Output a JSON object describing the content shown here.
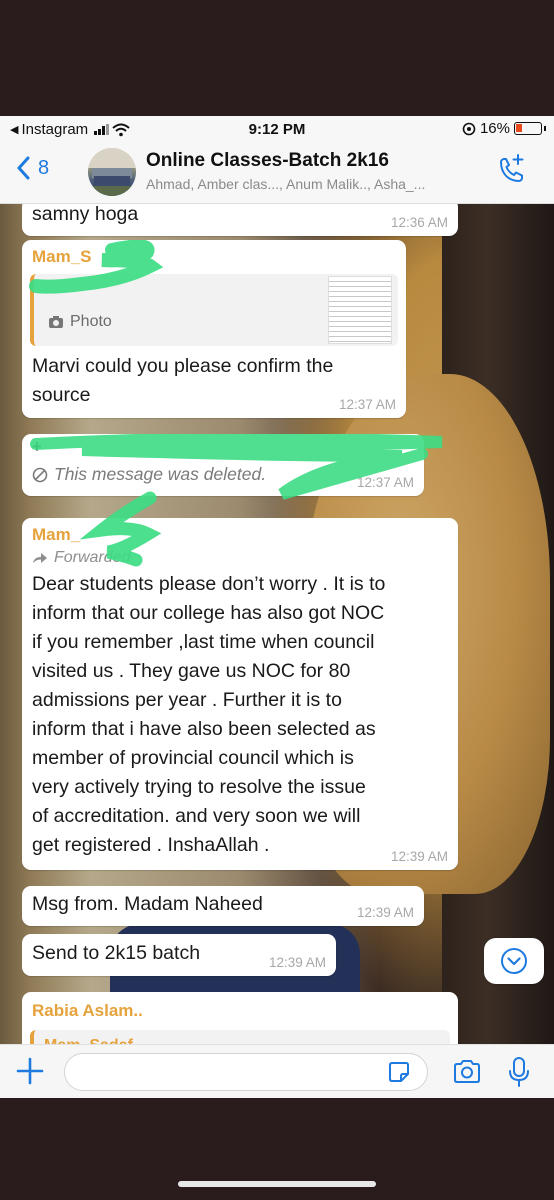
{
  "status_bar": {
    "back_app": "Instagram",
    "time": "9:12 PM",
    "battery": "16%"
  },
  "header": {
    "back_count": "8",
    "title": "Online Classes-Batch 2k16",
    "members": "Ahmad, Amber clas..., Anum Malik.., Asha_..."
  },
  "messages": {
    "m1": {
      "text": "samny hoga",
      "time": "12:36 AM"
    },
    "m2": {
      "sender": "Mam_S",
      "quote_label": "Photo",
      "text_line1": "Marvi could you please confirm the",
      "text_line2": "source",
      "time": "12:37 AM"
    },
    "m3": {
      "sender": "+",
      "deleted": "This message was deleted.",
      "time": "12:37 AM"
    },
    "m4": {
      "sender": "Mam_",
      "forwarded": "Forwarded",
      "lines": [
        "Dear students please don’t worry . It is to",
        "inform that our college has also got NOC",
        "if you remember ,last time when council",
        "visited us . They gave us NOC for 80",
        "admissions per year . Further it is to",
        "inform that i have also been selected as",
        "member of provincial council which is",
        "very actively trying to resolve the issue",
        "of accreditation. and very soon we will",
        "get registered . InshaAllah ."
      ],
      "time": "12:39 AM"
    },
    "m5": {
      "text": "Msg from. Madam Naheed",
      "time": "12:39 AM"
    },
    "m6": {
      "text": "Send to 2k15 batch",
      "time": "12:39 AM"
    },
    "m7": {
      "sender": "Rabia Aslam..",
      "quote_sender": "Mam_Sadaf.."
    }
  },
  "input": {
    "placeholder": ""
  },
  "colors": {
    "accent_blue": "#1f7ae0",
    "sender_orange": "#e6a23c",
    "scribble_green": "#3ddc84"
  }
}
